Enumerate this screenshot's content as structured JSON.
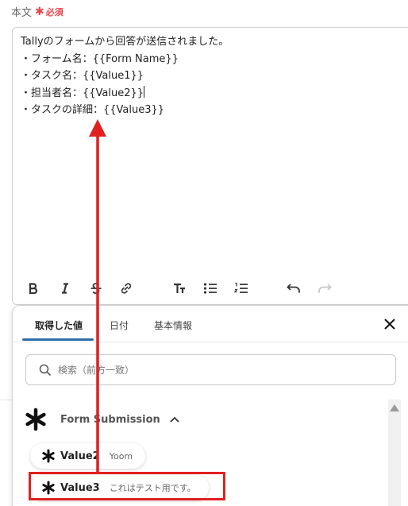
{
  "field": {
    "label": "本文",
    "required_text": "必須"
  },
  "editor": {
    "lines": [
      "Tallyのフォームから回答が送信されました。",
      "・フォーム名：{{Form Name}}",
      "・タスク名：{{Value1}}",
      "・担当者名：{{Value2}}",
      "・タスクの詳細：{{Value3}}"
    ]
  },
  "toolbar": {
    "icons": [
      "bold-icon",
      "italic-icon",
      "strikethrough-icon",
      "link-icon",
      "text-format-icon",
      "bullet-list-icon",
      "numbered-list-icon",
      "undo-icon",
      "redo-icon"
    ]
  },
  "panel": {
    "tabs": [
      {
        "label": "取得した値",
        "active": true
      },
      {
        "label": "日付",
        "active": false
      },
      {
        "label": "基本情報",
        "active": false
      }
    ],
    "search_placeholder": "検索（前方一致）",
    "group": {
      "label": "Form Submission",
      "items": [
        {
          "name": "Value2",
          "sub": "Yoom"
        },
        {
          "name": "Value3",
          "sub": "これはテスト用です。"
        }
      ]
    }
  },
  "colors": {
    "accent": "#2d6ea8",
    "required": "#e5484d",
    "annotation": "#e02020"
  }
}
